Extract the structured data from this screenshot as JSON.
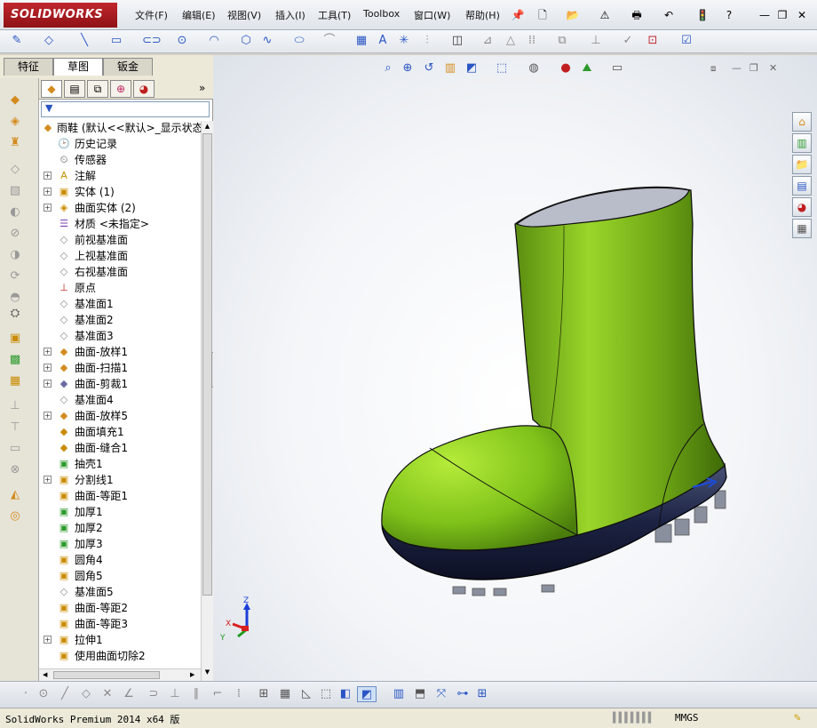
{
  "app": {
    "logo_text": "SOLIDWORKS",
    "brand_color": "#c1272d"
  },
  "menu": [
    "文件(F)",
    "编辑(E)",
    "视图(V)",
    "插入(I)",
    "工具(T)",
    "Toolbox",
    "窗口(W)",
    "帮助(H)"
  ],
  "cm_tabs": [
    "特征",
    "草图",
    "钣金"
  ],
  "tree": {
    "root": "雨鞋 (默认<<默认>_显示状态",
    "filter_icon": "filter-icon",
    "items": [
      {
        "label": "历史记录",
        "exp": false
      },
      {
        "label": "传感器",
        "exp": false
      },
      {
        "label": "注解",
        "exp": true
      },
      {
        "label": "实体 (1)",
        "exp": true
      },
      {
        "label": "曲面实体 (2)",
        "exp": true
      },
      {
        "label": "材质 <未指定>",
        "exp": false
      },
      {
        "label": "前视基准面",
        "exp": false
      },
      {
        "label": "上视基准面",
        "exp": false
      },
      {
        "label": "右视基准面",
        "exp": false
      },
      {
        "label": "原点",
        "exp": false
      },
      {
        "label": "基准面1",
        "exp": false
      },
      {
        "label": "基准面2",
        "exp": false
      },
      {
        "label": "基准面3",
        "exp": false
      },
      {
        "label": "曲面-放样1",
        "exp": true
      },
      {
        "label": "曲面-扫描1",
        "exp": true
      },
      {
        "label": "曲面-剪裁1",
        "exp": true
      },
      {
        "label": "基准面4",
        "exp": false
      },
      {
        "label": "曲面-放样5",
        "exp": true
      },
      {
        "label": "曲面填充1",
        "exp": false
      },
      {
        "label": "曲面-缝合1",
        "exp": false
      },
      {
        "label": "抽壳1",
        "exp": false
      },
      {
        "label": "分割线1",
        "exp": true
      },
      {
        "label": "曲面-等距1",
        "exp": false
      },
      {
        "label": "加厚1",
        "exp": false
      },
      {
        "label": "加厚2",
        "exp": false
      },
      {
        "label": "加厚3",
        "exp": false
      },
      {
        "label": "圆角4",
        "exp": false
      },
      {
        "label": "圆角5",
        "exp": false
      },
      {
        "label": "基准面5",
        "exp": false
      },
      {
        "label": "曲面-等距2",
        "exp": false
      },
      {
        "label": "曲面-等距3",
        "exp": false
      },
      {
        "label": "拉伸1",
        "exp": true
      },
      {
        "label": "使用曲面切除2",
        "exp": false
      }
    ]
  },
  "triad": {
    "x": "X",
    "y": "Y",
    "z": "Z"
  },
  "status": {
    "product": "SolidWorks Premium 2014 x64 版",
    "units": "MMGS"
  },
  "colors": {
    "boot": "#7fc21a",
    "sole": "#1c2242"
  }
}
